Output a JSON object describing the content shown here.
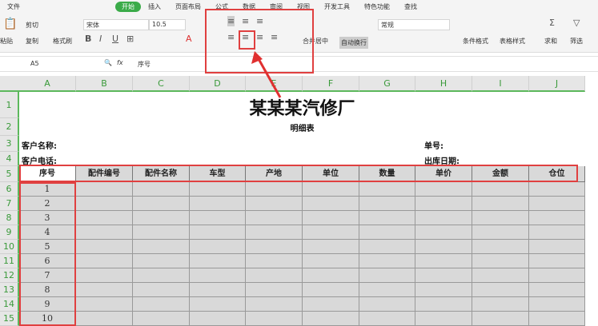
{
  "menu": {
    "items": [
      "文件",
      "开始",
      "插入",
      "页面布局",
      "公式",
      "数据",
      "审阅",
      "视图",
      "开发工具",
      "特色功能",
      "查找"
    ],
    "active": "开始"
  },
  "ribbon": {
    "paste": "粘贴",
    "cut": "剪切",
    "copy": "复制",
    "format_painter": "格式刷",
    "font": "宋体",
    "font_size": "10.5",
    "merge_center": "合并居中",
    "wrap_text": "自动换行",
    "number_format": "常规",
    "conditional_format": "条件格式",
    "table_style": "表格样式",
    "sum": "求和",
    "filter": "筛选"
  },
  "formula_bar": {
    "cell_ref": "A5",
    "fx": "fx",
    "value": "序号"
  },
  "columns": [
    "A",
    "B",
    "C",
    "D",
    "E",
    "F",
    "G",
    "H",
    "I",
    "J"
  ],
  "rows": [
    "1",
    "2",
    "3",
    "4",
    "5",
    "6",
    "7",
    "8",
    "9",
    "10",
    "11",
    "12",
    "13",
    "14",
    "15"
  ],
  "sheet": {
    "title": "某某某汽修厂",
    "subtitle": "明细表",
    "customer_name": "客户名称:",
    "order_no": "单号:",
    "customer_phone": "客户电话:",
    "out_date": "出库日期:",
    "headers": [
      "序号",
      "配件编号",
      "配件名称",
      "车型",
      "产地",
      "单位",
      "数量",
      "单价",
      "金额",
      "仓位"
    ],
    "serials": [
      "1",
      "2",
      "3",
      "4",
      "5",
      "6",
      "7",
      "8",
      "9",
      "10"
    ]
  },
  "colors": {
    "accent": "#3bab49",
    "highlight": "#e04040"
  }
}
